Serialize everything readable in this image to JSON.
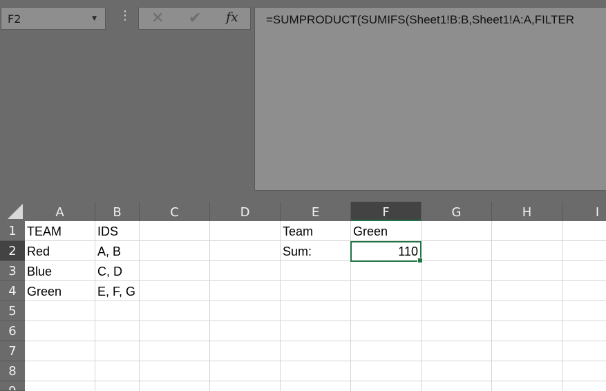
{
  "name_box": {
    "value": "F2"
  },
  "formula_bar": {
    "icons": [
      "cancel-icon",
      "enter-icon",
      "fx-icon"
    ],
    "formula": "=SUMPRODUCT(SUMIFS(Sheet1!B:B,Sheet1!A:A,FILTER"
  },
  "colors": {
    "selection": "#217346",
    "chrome": "#6b6b6b"
  },
  "columns": [
    "A",
    "B",
    "C",
    "D",
    "E",
    "F",
    "G",
    "H",
    "I"
  ],
  "rows": [
    "1",
    "2",
    "3",
    "4",
    "5",
    "6",
    "7",
    "8",
    "9"
  ],
  "selected": {
    "column": "F",
    "row": "2"
  },
  "cells": {
    "A1": "TEAM",
    "B1": "IDS",
    "E1": "Team",
    "F1": "Green",
    "A2": "Red",
    "B2": "A, B",
    "E2": "Sum:",
    "F2": "110",
    "A3": "Blue",
    "B3": "C, D",
    "A4": "Green",
    "B4": "E, F, G"
  }
}
